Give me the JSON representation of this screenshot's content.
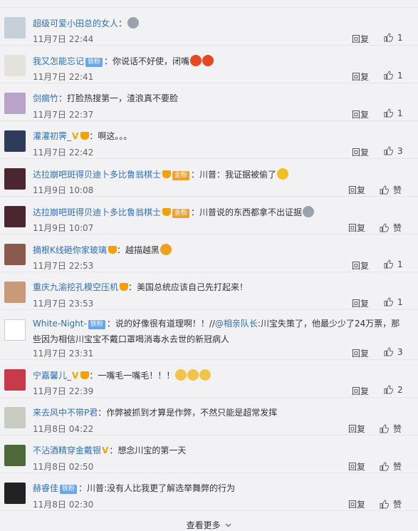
{
  "comments": [
    {
      "user": "超级可爱小田总的女人",
      "badges": [],
      "text": "：",
      "time": "11月7日 22:44",
      "reply": "回复",
      "like": "1",
      "avatar": "#c7cfd8",
      "emojis": [
        "#9aa3ad"
      ]
    },
    {
      "user": "我又怎能忘记",
      "badges": [
        "铁粉"
      ],
      "text": "：你说话不好使，闭嘴",
      "time": "11月7日 22:41",
      "reply": "回复",
      "like": "1",
      "avatar": "#e4e2dc",
      "emojis": [
        "#e34a1f",
        "#e34a1f"
      ]
    },
    {
      "user": "剑瘸竹",
      "badges": [],
      "text": "：打脸热搜第一，渣浪真不要脸",
      "time": "11月7日 22:37",
      "reply": "回复",
      "like": "1",
      "avatar": "#b9a3c9",
      "emojis": []
    },
    {
      "user": "灌灌初霁_",
      "badges": [
        "V",
        "crown"
      ],
      "text": "：啊这。。。",
      "time": "11月7日 22:42",
      "reply": "回复",
      "like": "3",
      "avatar": "#2e3b5a",
      "emojis": []
    },
    {
      "user": "达拉崩吧斑得贝迪卜多比鲁翁棋士",
      "badges": [
        "crown",
        "金粉"
      ],
      "text": "：川普：我证据被偷了",
      "time": "11月9日 10:08",
      "reply": "回复",
      "like": "赞",
      "avatar": "#4a2630",
      "emojis": [
        "#f0c020"
      ]
    },
    {
      "user": "达拉崩吧斑得贝迪卜多比鲁翁棋士",
      "badges": [
        "crown",
        "金粉"
      ],
      "text": "：川普说的东西都拿不出证据",
      "time": "11月9日 10:07",
      "reply": "回复",
      "like": "赞",
      "avatar": "#4a2630",
      "emojis": [
        "#9aa3ad"
      ]
    },
    {
      "user": "摘根K线砸你家玻璃",
      "badges": [
        "crown"
      ],
      "text": "：越描越黑",
      "time": "11月7日 22:53",
      "reply": "回复",
      "like": "1",
      "avatar": "#8a5a4e",
      "emojis": [
        "#f0a020"
      ]
    },
    {
      "user": "重庆九渝挖孔模空压机",
      "badges": [
        "crown"
      ],
      "text": "：美国总统应该自己先打起来！",
      "time": "11月7日 23:53",
      "reply": "回复",
      "like": "1",
      "avatar": "#c99a7a",
      "emojis": []
    },
    {
      "user": "White-Night-",
      "badges": [
        "铁粉"
      ],
      "text": "：说的好像很有道理啊！！//",
      "mention": "@相亲队长",
      "text2": ":川宝失策了，他最少少了24万票，那些因为相信川宝宝不戴口罩喝消毒水去世的新冠病人",
      "time": "11月7日 23:31",
      "reply": "回复",
      "like": "3",
      "avatar": "#ffffff",
      "emojis": []
    },
    {
      "user": "宁嘉馨儿_",
      "badges": [
        "V",
        "crown"
      ],
      "text": "：一嘴毛一嘴毛！！！",
      "time": "11月7日 22:39",
      "reply": "回复",
      "like": "2",
      "avatar": "#c83a4a",
      "emojis": [
        "#f2c44a",
        "#f2c44a",
        "#f2c44a"
      ]
    },
    {
      "user": "来去风中不带P君",
      "badges": [],
      "text": "：作弊被抓到才算是作弊，不然只能是超常发挥",
      "time": "11月8日 04:22",
      "reply": "回复",
      "like": "赞",
      "avatar": "#c8ccc0",
      "emojis": []
    },
    {
      "user": "不沾酒精穿金戴银",
      "badges": [
        "V"
      ],
      "text": "：想念川宝的第一天",
      "time": "11月8日 02:50",
      "reply": "回复",
      "like": "赞",
      "avatar": "#4f6a3a",
      "emojis": []
    },
    {
      "user": "赫睿佳",
      "badges": [
        "铁粉"
      ],
      "text": "：川普:没有人比我更了解选举舞弊的行为",
      "time": "11月8日 02:30",
      "reply": "回复",
      "like": "赞",
      "avatar": "#222222",
      "emojis": []
    }
  ],
  "footer": {
    "more_label": "查看更多"
  },
  "icons": {
    "like": "thumbs-up-icon",
    "more": "chevron-down-icon"
  }
}
